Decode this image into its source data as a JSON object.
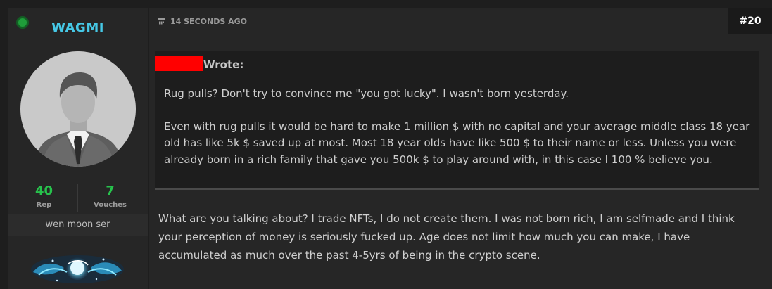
{
  "user": {
    "name": "WAGMI",
    "online": true,
    "rep_value": "40",
    "rep_label": "Rep",
    "vouches_value": "7",
    "vouches_label": "Vouches",
    "title": "wen moon ser"
  },
  "post": {
    "time_ago": "14 SECONDS AGO",
    "number": "#20",
    "quote": {
      "author_redacted": true,
      "wrote_label": "Wrote:",
      "paragraphs": [
        "Rug pulls? Don't try to convince me \"you got lucky\". I wasn't born yesterday.",
        "Even with rug pulls it would be hard to make 1 million $ with no capital and your average middle class 18 year old has like 5k $ saved up at most. Most 18 year olds have like 500 $ to their name or less. Unless you were already born in a rich family that gave you 500k $ to play around with, in this case I 100 % believe you."
      ]
    },
    "body": "What are you talking about? I trade NFTs, I do not create them. I was not born rich, I am selfmade and I think your perception of money is seriously fucked up. Age does not limit how much you can make, I have accumulated as much over the past 4-5yrs of being in the crypto scene."
  },
  "icons": {
    "status": "online-status-icon",
    "time": "calendar-icon",
    "avatar": "default-avatar-icon",
    "badge": "user-badge-icon"
  },
  "colors": {
    "username": "#46c8e6",
    "stat_numbers": "#27c24c",
    "online": "#1f9d3a",
    "redaction": "#ff0000"
  }
}
